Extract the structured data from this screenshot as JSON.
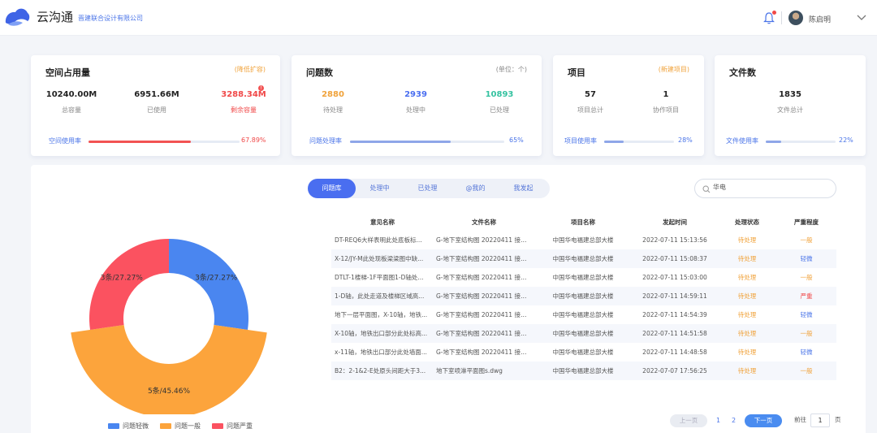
{
  "header": {
    "app_name": "云沟通",
    "company": "晋建联合设计有限公司",
    "username": "陈启明"
  },
  "cards": {
    "space": {
      "title": "空间占用量",
      "note": "(降低扩容)",
      "total_value": "10240.00M",
      "total_label": "总容量",
      "used_value": "6951.66M",
      "used_label": "已使用",
      "remain_value": "3288.34M",
      "remain_label": "剩余容量",
      "badge": "!",
      "bar_label": "空间使用率",
      "bar_pct": "67.89%",
      "bar_fraction": 0.6789
    },
    "issues": {
      "title": "问题数",
      "note": "(单位：个)",
      "pending_value": "2880",
      "pending_label": "待处理",
      "processing_value": "2939",
      "processing_label": "处理中",
      "done_value": "10893",
      "done_label": "已处理",
      "bar_label": "问题处理率",
      "bar_pct": "65%",
      "bar_fraction": 0.65
    },
    "projects": {
      "title": "项目",
      "note": "(新建项目)",
      "total_value": "57",
      "total_label": "项目总计",
      "collab_value": "1",
      "collab_label": "协作项目",
      "bar_label": "项目使用率",
      "bar_pct": "28%",
      "bar_fraction": 0.28
    },
    "files": {
      "title": "文件数",
      "total_value": "1835",
      "total_label": "文件总计",
      "bar_label": "文件使用率",
      "bar_pct": "22%",
      "bar_fraction": 0.22
    }
  },
  "colors": {
    "blue": "#4a86f0",
    "orange": "#fca43c",
    "red": "#fb5260",
    "accent": "#4a6ef0"
  },
  "chart_data": {
    "type": "pie",
    "labels": [
      "问题轻微",
      "问题一般",
      "问题严重"
    ],
    "values": [
      3,
      5,
      3
    ],
    "data_labels": [
      "3条/27.27%",
      "5条/45.46%",
      "3条/27.27%"
    ],
    "colors": [
      "#4a86f0",
      "#fca43c",
      "#fb5260"
    ],
    "legend_position": "bottom"
  },
  "tabs": [
    "问题库",
    "处理中",
    "已处理",
    "@我的",
    "我发起"
  ],
  "search": {
    "value": "华电"
  },
  "table": {
    "headers": [
      "意见名称",
      "文件名称",
      "项目名称",
      "发起时间",
      "处理状态",
      "严重程度"
    ],
    "rows": [
      [
        "DT-REQ6大样表明此处底板标...",
        "G-地下室结构图 20220411 接地...",
        "中国华电福建总部大楼",
        "2022-07-11 15:13:56",
        "待处理",
        "一般"
      ],
      [
        "X-12/JY-M此处现板梁梁图中缺...",
        "G-地下室结构图 20220411 接地...",
        "中国华电福建总部大楼",
        "2022-07-11 15:08:37",
        "待处理",
        "轻微"
      ],
      [
        "DTLT-1楼梯-1F平面图1-D轴处...",
        "G-地下室结构图 20220411 接地...",
        "中国华电福建总部大楼",
        "2022-07-11 15:03:00",
        "待处理",
        "一般"
      ],
      [
        "1-D轴，此处走道及楼梯区域高...",
        "G-地下室结构图 20220411 接地...",
        "中国华电福建总部大楼",
        "2022-07-11 14:59:11",
        "待处理",
        "严重"
      ],
      [
        "地下一层平面图，X-10轴，地铁...",
        "G-地下室结构图 20220411 接地...",
        "中国华电福建总部大楼",
        "2022-07-11 14:54:39",
        "待处理",
        "轻微"
      ],
      [
        "X-10轴，地铁出口部分此处标高...",
        "G-地下室结构图 20220411 接地...",
        "中国华电福建总部大楼",
        "2022-07-11 14:51:58",
        "待处理",
        "一般"
      ],
      [
        "x-11轴，地铁出口部分此处墙面...",
        "G-地下室结构图 20220411 接地...",
        "中国华电福建总部大楼",
        "2022-07-11 14:48:58",
        "待处理",
        "轻微"
      ],
      [
        "B2：2-1&2-E处原头间距大于3...",
        "地下室喷淋平面图s.dwg",
        "中国华电福建总部大楼",
        "2022-07-07 17:56:25",
        "待处理",
        "一般"
      ]
    ],
    "severity_colors": {
      "一般": "sev-orange",
      "轻微": "sev-blue",
      "严重": "sev-red"
    }
  },
  "pagination": {
    "prev": "上一页",
    "pages": [
      "1",
      "2"
    ],
    "next": "下一页",
    "goto_label": "前往",
    "goto_value": "1",
    "goto_unit": "页"
  }
}
